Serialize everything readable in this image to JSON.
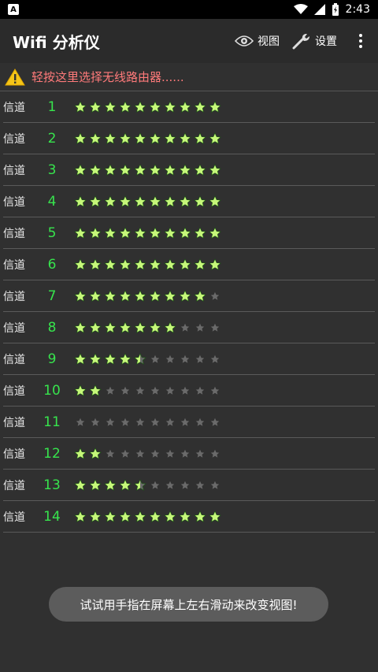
{
  "status_bar": {
    "time": "2:43",
    "notification_letter": "A"
  },
  "app_bar": {
    "title": "Wifi 分析仪",
    "view_label": "视图",
    "settings_label": "设置"
  },
  "router_prompt": "轻按这里选择无线路由器......",
  "channel_label": "信道",
  "channels": [
    {
      "number": "1",
      "rating": 10
    },
    {
      "number": "2",
      "rating": 10
    },
    {
      "number": "3",
      "rating": 10
    },
    {
      "number": "4",
      "rating": 10
    },
    {
      "number": "5",
      "rating": 10
    },
    {
      "number": "6",
      "rating": 10
    },
    {
      "number": "7",
      "rating": 9
    },
    {
      "number": "8",
      "rating": 7
    },
    {
      "number": "9",
      "rating": 4.5
    },
    {
      "number": "10",
      "rating": 2
    },
    {
      "number": "11",
      "rating": 0
    },
    {
      "number": "12",
      "rating": 2
    },
    {
      "number": "13",
      "rating": 4.5
    },
    {
      "number": "14",
      "rating": 10
    }
  ],
  "max_stars": 10,
  "toast": "试试用手指在屏幕上左右滑动来改变视图!",
  "colors": {
    "star_on": "#c6f77a",
    "star_off": "#6a6a6a",
    "channel_number": "#37e44d",
    "prompt": "#ff7a7a"
  }
}
